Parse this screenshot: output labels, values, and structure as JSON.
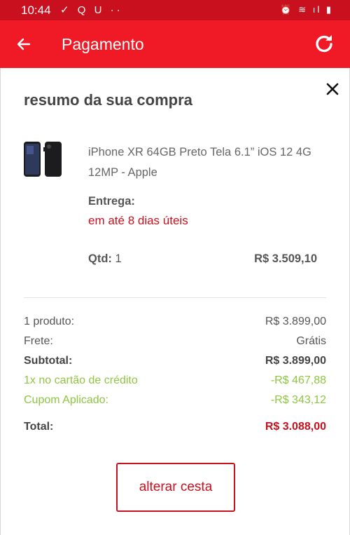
{
  "status_bar": {
    "time": "10:44",
    "left_icons": "✓ Q U ··",
    "right_icons": "⏰ ≋ ıl ▮"
  },
  "app_bar": {
    "title": "Pagamento",
    "back_icon": "arrow-left-icon",
    "refresh_icon": "refresh-icon"
  },
  "summary": {
    "title": "resumo da sua compra",
    "close_icon": "close-icon",
    "product": {
      "name": "iPhone XR 64GB Preto Tela 6.1” iOS 12 4G 12MP - Apple",
      "delivery_label": "Entrega:",
      "delivery_value": "em até 8 dias úteis",
      "qty_label": "Qtd:",
      "qty_value": "1",
      "price": "R$ 3.509,10"
    },
    "rows": {
      "products": {
        "label": "1 produto:",
        "value": "R$ 3.899,00"
      },
      "shipping": {
        "label": "Frete:",
        "value": "Grátis"
      },
      "subtotal": {
        "label": "Subtotal:",
        "value": "R$ 3.899,00"
      },
      "card_discount": {
        "label": "1x no cartão de crédito",
        "value": "-R$ 467,88"
      },
      "coupon": {
        "label": "Cupom Aplicado:",
        "value": "-R$ 343,12"
      },
      "total": {
        "label": "Total:",
        "value": "R$ 3.088,00"
      }
    },
    "change_cart_label": "alterar cesta"
  },
  "colors": {
    "header_red": "#ef1a26",
    "status_red": "#c8101e",
    "accent_red": "#c8101e",
    "discount_green": "#8dc63f"
  }
}
